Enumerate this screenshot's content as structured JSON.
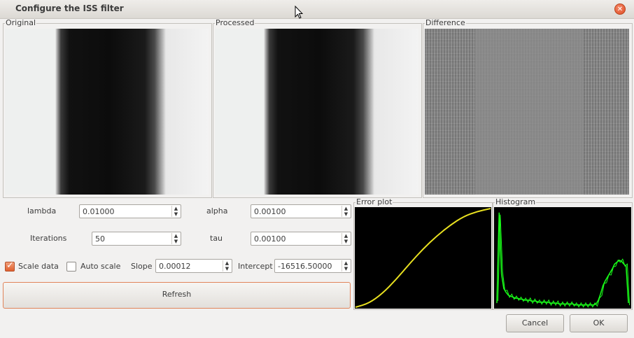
{
  "window": {
    "title": "Configure the ISS filter"
  },
  "panels": {
    "original": "Original",
    "processed": "Processed",
    "difference": "Difference",
    "error_plot": "Error plot",
    "histogram": "Histogram"
  },
  "params": {
    "lambda": {
      "label": "lambda",
      "value": "0.01000"
    },
    "alpha": {
      "label": "alpha",
      "value": "0.00100"
    },
    "iterations": {
      "label": "Iterations",
      "value": "50"
    },
    "tau": {
      "label": "tau",
      "value": "0.00100"
    }
  },
  "scaling": {
    "scale_data": {
      "label": "Scale data",
      "checked": true
    },
    "auto_scale": {
      "label": "Auto scale",
      "checked": false
    },
    "slope": {
      "label": "Slope",
      "value": "0.00012"
    },
    "intercept": {
      "label": "Intercept",
      "value": "-16516.50000"
    }
  },
  "buttons": {
    "refresh": "Refresh",
    "cancel": "Cancel",
    "ok": "OK"
  },
  "colors": {
    "accent": "#e0602f",
    "error_curve": "#e8e020",
    "histogram": "#19ff19"
  },
  "icons": {
    "close": "close-icon",
    "check": "check-icon",
    "spin_up": "spin-up-icon",
    "spin_down": "spin-down-icon"
  },
  "error_plot_data": {
    "type": "line",
    "x": [
      0,
      0.1,
      0.2,
      0.3,
      0.4,
      0.5,
      0.6,
      0.7,
      0.8,
      0.9,
      1.0
    ],
    "y": [
      0,
      0.04,
      0.14,
      0.28,
      0.44,
      0.59,
      0.72,
      0.83,
      0.92,
      0.97,
      1.0
    ]
  },
  "histogram_data": {
    "type": "histogram",
    "bins": [
      0.05,
      0.98,
      0.35,
      0.2,
      0.16,
      0.13,
      0.12,
      0.11,
      0.1,
      0.1,
      0.09,
      0.09,
      0.08,
      0.08,
      0.08,
      0.07,
      0.07,
      0.07,
      0.06,
      0.06,
      0.06,
      0.06,
      0.06,
      0.05,
      0.05,
      0.05,
      0.05,
      0.04,
      0.04,
      0.04,
      0.04,
      0.04,
      0.04,
      0.04,
      0.03,
      0.03,
      0.03,
      0.03,
      0.03,
      0.03,
      0.03,
      0.03,
      0.03,
      0.04,
      0.08,
      0.15,
      0.23,
      0.28,
      0.32,
      0.36,
      0.4,
      0.45,
      0.47,
      0.49,
      0.48,
      0.45,
      0.43,
      0.05
    ]
  }
}
